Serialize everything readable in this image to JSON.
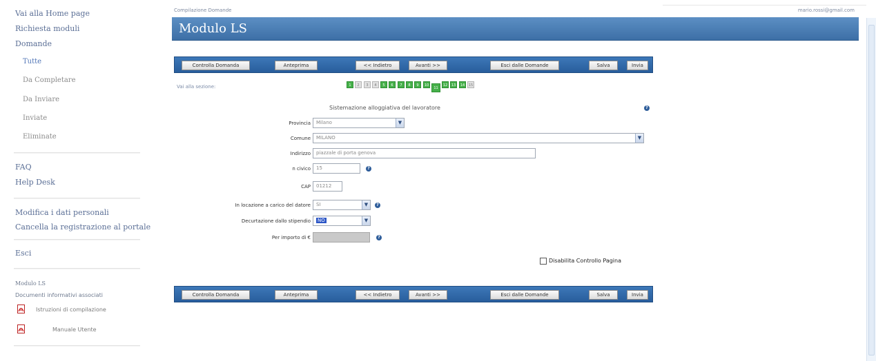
{
  "sidebar": {
    "home": "Vai alla Home page",
    "request_forms": "Richiesta moduli",
    "applications": "Domande",
    "sub_items": [
      "Tutte",
      "Da Completare",
      "Da Inviare",
      "Inviate",
      "Eliminate"
    ],
    "faq": "FAQ",
    "help_desk": "Help Desk",
    "edit_profile": "Modifica i dati personali",
    "delete_registration": "Cancella la registrazione al portale",
    "exit": "Esci",
    "module_name": "Modulo LS",
    "docs_heading": "Documenti informativi associati",
    "docs": [
      "Istruzioni di compilazione",
      "Manuale Utente"
    ]
  },
  "header": {
    "breadcrumb": "Compilazione Domande",
    "user_email": "mario.rossi@gmail.com",
    "title": "Modulo LS"
  },
  "toolbar": {
    "check": "Controlla Domanda",
    "preview": "Anteprima",
    "back": "<< Indietro",
    "next": "Avanti >>",
    "exit": "Esci dalle Domande",
    "save": "Salva",
    "send": "Invia"
  },
  "nav": {
    "goto_label": "Vai alla sezione:",
    "sections": [
      {
        "label": "1",
        "state": "green"
      },
      {
        "label": "2",
        "state": "gray"
      },
      {
        "label": "3",
        "state": "gray"
      },
      {
        "label": "4",
        "state": "gray"
      },
      {
        "label": "5",
        "state": "green"
      },
      {
        "label": "6",
        "state": "green"
      },
      {
        "label": "7",
        "state": "green"
      },
      {
        "label": "8",
        "state": "green"
      },
      {
        "label": "9",
        "state": "green"
      },
      {
        "label": "10",
        "state": "green"
      },
      {
        "label": "11",
        "state": "current"
      },
      {
        "label": "12",
        "state": "green"
      },
      {
        "label": "13",
        "state": "green"
      },
      {
        "label": "14",
        "state": "green"
      },
      {
        "label": "15",
        "state": "gray"
      }
    ]
  },
  "form": {
    "section_title": "Sistemazione alloggiativa del lavoratore",
    "provincia_label": "Provincia",
    "provincia_value": "Milano",
    "comune_label": "Comune",
    "comune_value": "MILANO",
    "indirizzo_label": "Indirizzo",
    "indirizzo_value": "piazzale di porta genova",
    "civico_label": "n civico",
    "civico_value": "15",
    "cap_label": "CAP",
    "cap_value": "01212",
    "locazione_label": "In locazione a carico del datore",
    "locazione_value": "SI",
    "decurtazione_label": "Decurtazione dallo stipendio",
    "decurtazione_value": "NO",
    "importo_label": "Per importo di €",
    "importo_value": "",
    "disable_check_label": "Disabilita Controllo Pagina"
  },
  "colors": {
    "header_blue": "#3d6fa6",
    "toolbar_blue": "#285d9c",
    "section_green": "#46b04a"
  }
}
